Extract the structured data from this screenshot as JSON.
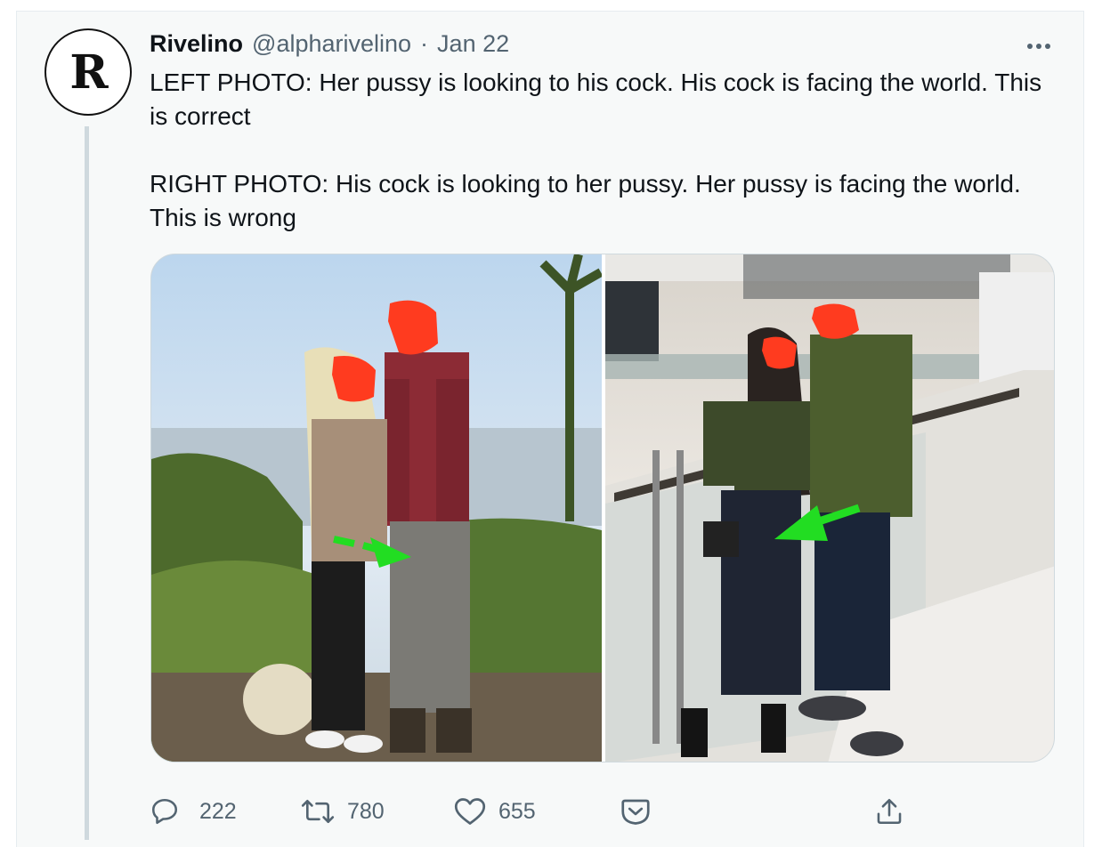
{
  "tweet": {
    "display_name": "Rivelino",
    "handle": "@alpharivelino",
    "separator": "·",
    "date": "Jan 22",
    "avatar_letter": "R",
    "text_lines": [
      "LEFT PHOTO: Her pussy is looking to his cock. His cock is facing the world. This is correct",
      "RIGHT PHOTO: His cock is looking to her pussy. Her pussy is facing the world. This is wrong"
    ]
  },
  "actions": {
    "reply": {
      "icon": "reply-icon",
      "count": "222"
    },
    "retweet": {
      "icon": "retweet-icon",
      "count": "780"
    },
    "like": {
      "icon": "heart-icon",
      "count": "655"
    },
    "bookmark": {
      "icon": "bookmark-icon"
    },
    "share": {
      "icon": "share-icon"
    }
  },
  "colors": {
    "text_primary": "#0f1419",
    "text_secondary": "#536471",
    "card_background": "#f7f9f9",
    "thread_line": "#cfd9de",
    "face_cover": "#ff3b1f",
    "arrow": "#22dd22"
  }
}
